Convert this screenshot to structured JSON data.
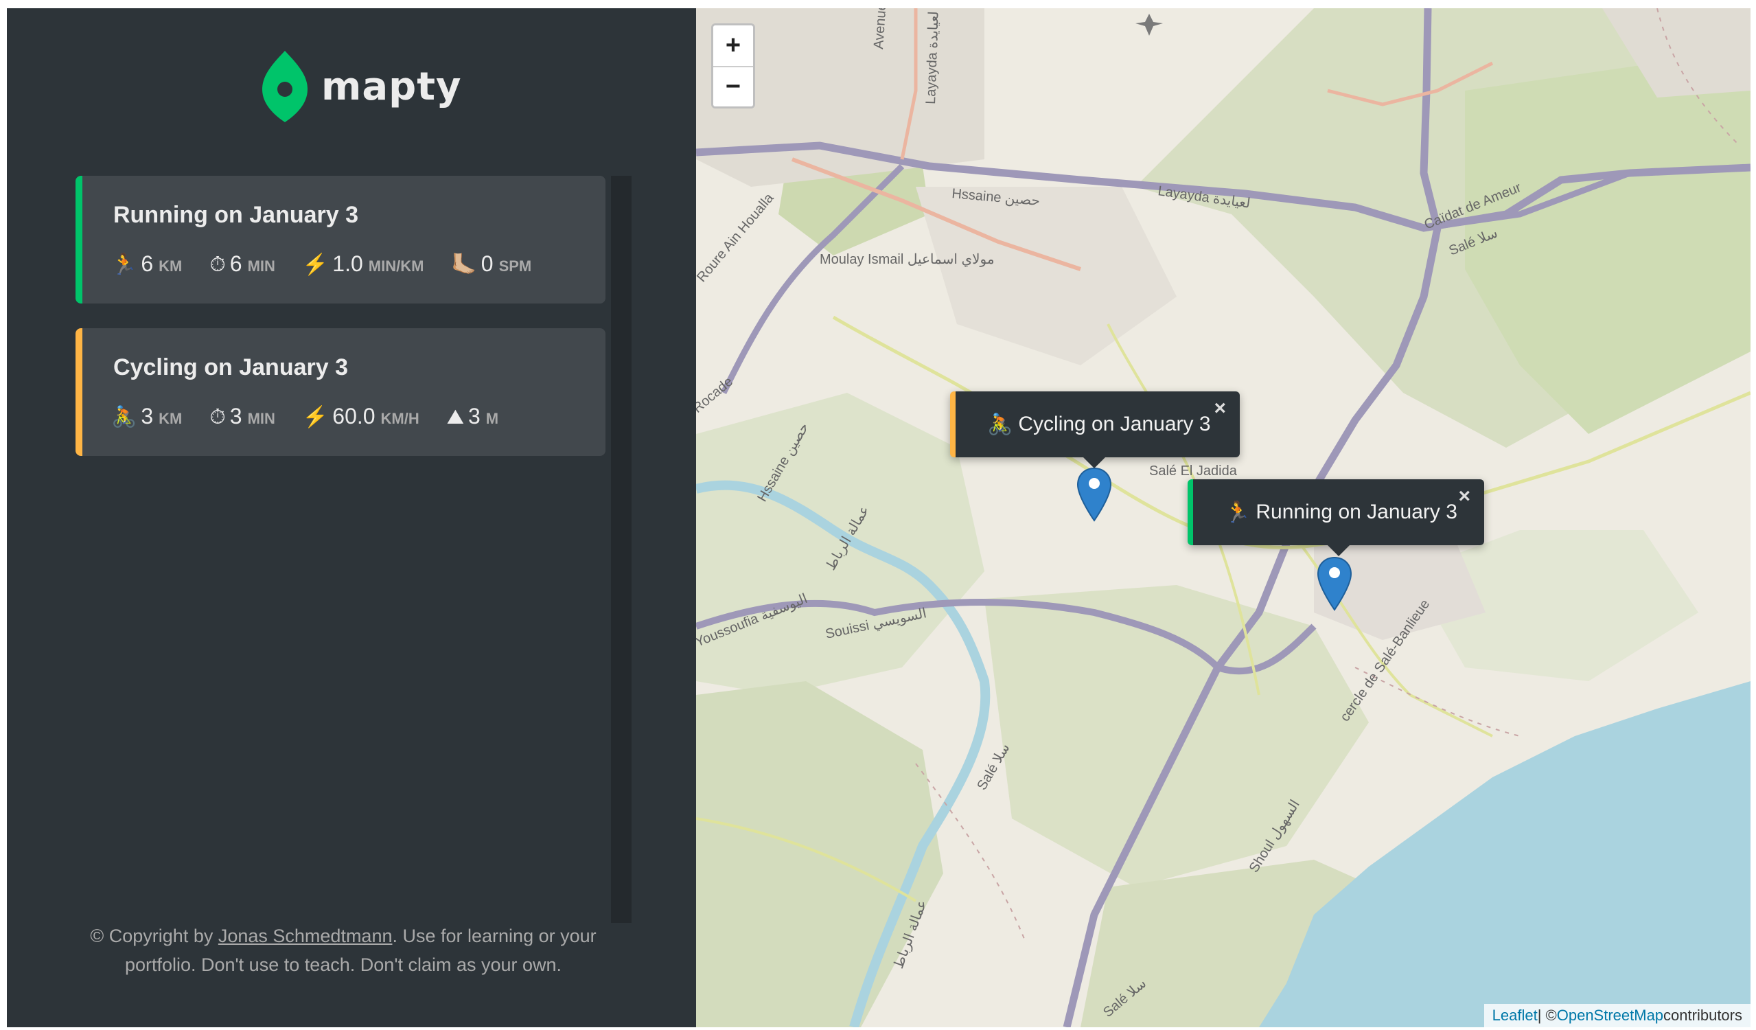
{
  "app": {
    "name": "mapty"
  },
  "workouts": [
    {
      "type": "running",
      "title": "Running on January 3",
      "details": [
        {
          "icon": "🏃",
          "icon_name": "runner-icon",
          "value": "6",
          "unit": "km"
        },
        {
          "icon": "⏱",
          "icon_name": "stopwatch-icon",
          "value": "6",
          "unit": "min"
        },
        {
          "icon": "⚡️",
          "icon_name": "lightning-icon",
          "value": "1.0",
          "unit": "min/km"
        },
        {
          "icon": "🦶🏼",
          "icon_name": "footprint-icon",
          "value": "0",
          "unit": "spm"
        }
      ]
    },
    {
      "type": "cycling",
      "title": "Cycling on January 3",
      "details": [
        {
          "icon": "🚴",
          "icon_name": "cyclist-icon",
          "value": "3",
          "unit": "km"
        },
        {
          "icon": "⏱",
          "icon_name": "stopwatch-icon",
          "value": "3",
          "unit": "min"
        },
        {
          "icon": "⚡️",
          "icon_name": "lightning-icon",
          "value": "60.0",
          "unit": "km/h"
        },
        {
          "icon": "⛰",
          "icon_name": "mountain-icon",
          "value": "3",
          "unit": "m"
        }
      ]
    }
  ],
  "copyright": {
    "prefix": "© Copyright by ",
    "author": "Jonas Schmedtmann",
    "suffix": ". Use for learning or your portfolio. Don't use to teach. Don't claim as your own."
  },
  "map": {
    "zoom_in_label": "+",
    "zoom_out_label": "−",
    "popups": [
      {
        "type": "cycling",
        "icon": "🚴",
        "text": "Cycling on January 3",
        "close": "×"
      },
      {
        "type": "running",
        "icon": "🏃",
        "text": "Running on January 3",
        "close": "×"
      }
    ],
    "labels": [
      "Avenue de l'Aviation",
      "Layayda لعيايدة",
      "Hssaine حصين",
      "Layayda لعيايدة",
      "Moulay Ismail مولاي اسماعيل",
      "Roure Ain Houalla",
      "Caïdat de Ameur",
      "Salé سلا",
      "Salé El Jadida",
      "Youssoufia اليوسفية",
      "Souissi السويسي",
      "Salé سلا",
      "Shoul السهول",
      "cercle de Salé-Banlieue",
      "Hssaine حصين",
      "Rocade",
      "عمالة الرباط",
      "عمالة الرباط",
      "Salé سلا"
    ],
    "attribution": {
      "leaflet": "Leaflet",
      "separator": " | © ",
      "osm": "OpenStreetMap",
      "suffix": " contributors"
    }
  },
  "colors": {
    "sidebar_bg": "#2d3439",
    "card_bg": "#42484d",
    "running_accent": "#00c46a",
    "cycling_accent": "#ffb545",
    "logo_green": "#00c46a"
  }
}
